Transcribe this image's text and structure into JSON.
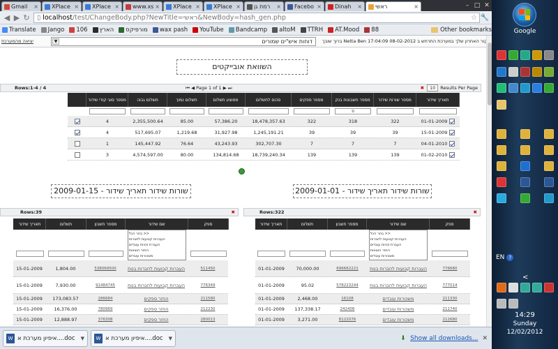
{
  "tabs": [
    {
      "label": "Gmail",
      "color": "#d44638"
    },
    {
      "label": "XPlace",
      "color": "#3a7bd5"
    },
    {
      "label": "XPlace",
      "color": "#3a7bd5"
    },
    {
      "label": "www.xs",
      "color": "#c43b3b"
    },
    {
      "label": "XPlace",
      "color": "#3a7bd5"
    },
    {
      "label": "XPlace",
      "color": "#3a7bd5"
    },
    {
      "label": "רמת גן",
      "color": "#555555"
    },
    {
      "label": "Facebo",
      "color": "#3b5998"
    },
    {
      "label": "Dinah",
      "color": "#cc2222"
    },
    {
      "label": "ראשי",
      "color": "#e8a33a"
    }
  ],
  "omnibox": {
    "host": "localhost",
    "path": "/test/ChangeBody.php?NewTitle=ראשי&NewBody=hash_gen.php"
  },
  "bookmarks": [
    {
      "label": "Translate",
      "color": "#4a8af4"
    },
    {
      "label": "Jango",
      "color": "#888888"
    },
    {
      "label": "106",
      "color": "#d04040"
    },
    {
      "label": "הארץ",
      "color": "#2b2b2b"
    },
    {
      "label": "מורפיקס",
      "color": "#2d6a2d"
    },
    {
      "label": "wax pash",
      "color": "#3b5998"
    },
    {
      "label": "YouTube",
      "color": "#cc0000"
    },
    {
      "label": "Bandcamp",
      "color": "#629aa9"
    },
    {
      "label": "altoM",
      "color": "#555555"
    },
    {
      "label": "TTRH",
      "color": "#444444"
    },
    {
      "label": "AT.Mood",
      "color": "#cc2222"
    },
    {
      "label": "88",
      "color": "#aa3333"
    }
  ],
  "other_bookmarks": "Other bookmarks",
  "topstrip": {
    "left_link": "יציאה מהמערכת",
    "select_value": "דוחות איש\"ים שמורים",
    "right_text": "ברוך שובך Netta Ben הביקור האחרון שלך במערכת התרחש ב 08-02-2012 17:04:09"
  },
  "main_title": "השוואת אובייקטים",
  "grid_top": {
    "rows_label": "Rows:1-4 / 4",
    "pager": "Page 1 of 1",
    "results_per_page": "Results Per Page",
    "rpp_value": "10",
    "headers": [
      "תאריך שידור",
      "מספר שורות שידור",
      "מספר חשבונות בנק",
      "מספר ספקים",
      "סכום לתשלום",
      "ממוצע תשלום",
      "תשלום נמוך",
      "תשלום גבוה",
      "מספר סוגי קודי שידור",
      ""
    ],
    "filter_value": "",
    "filter_bank": "פ",
    "rows": [
      {
        "date": "01-01-2009",
        "rows": "322",
        "banks": "318",
        "suppliers": "322",
        "sum": "18,478,357.63",
        "avg": "57,386.20",
        "low": "85.00",
        "high": "2,355,500.64",
        "types": "4",
        "checked": true,
        "date_checked": true
      },
      {
        "date": "15-01-2009",
        "rows": "39",
        "banks": "39",
        "suppliers": "39",
        "sum": "1,245,191.21",
        "avg": "31,927.98",
        "low": "1,219.68",
        "high": "517,695.07",
        "types": "4",
        "checked": true,
        "date_checked": true
      },
      {
        "date": "04-01-2010",
        "rows": "7",
        "banks": "7",
        "suppliers": "7",
        "sum": "302,707.30",
        "avg": "43,243.93",
        "low": "76.64",
        "high": "145,447.92",
        "types": "1",
        "checked": false,
        "date_checked": true
      },
      {
        "date": "01-02-2010",
        "rows": "139",
        "banks": "139",
        "suppliers": "139",
        "sum": "18,739,240.34",
        "avg": "134,814.68",
        "low": "80.00",
        "high": "4,574,597.00",
        "types": "3",
        "checked": false,
        "date_checked": true
      }
    ]
  },
  "section_right": {
    "title": "שורות שידור תאריך שידור - 2009-01-01",
    "rows_label": "Rows:322"
  },
  "section_left": {
    "title": "שורות שידור תאריך שידור - 2009-01-15",
    "rows_label": "Rows:39"
  },
  "sub_headers": [
    "ספק",
    "שם שידור",
    "מספר חשבון",
    "תשלום",
    "תאריך שידור"
  ],
  "multiselect_options": [
    "בחר הכל >>",
    "העברות קבועות לחברות",
    "העברת זכויות עובדים",
    "החזר הוצאות",
    "משכורות עובדים"
  ],
  "right_rows": [
    {
      "supplier": "776680",
      "name": "העברות קבועות לחברות בנות",
      "account": "696662221",
      "amount": "70,000.00",
      "date": "01-01-2009"
    },
    {
      "supplier": "777014",
      "name": "העברות קבועות לחברות בנות",
      "account": "578223244",
      "amount": "95.02",
      "date": "01-01-2009"
    },
    {
      "supplier": "211330",
      "name": "משכורות עובדים",
      "account": "16108",
      "amount": "2,468.00",
      "date": "01-01-2009"
    },
    {
      "supplier": "211740",
      "name": "משכורות עובדים",
      "account": "242406",
      "amount": "137,338.17",
      "date": "01-01-2009"
    },
    {
      "supplier": "212680",
      "name": "משכורות עובדים",
      "account": "8122076",
      "amount": "3,271.00",
      "date": "01-01-2009"
    }
  ],
  "left_rows": [
    {
      "supplier": "511450",
      "name": "העברות קבועות לחברות בנות",
      "account": "538069500",
      "amount": "1,804.00",
      "date": "15-01-2009"
    },
    {
      "supplier": "776349",
      "name": "העברות קבועות לחברות בנות",
      "account": "91484745",
      "amount": "7,930.00",
      "date": "15-01-2009"
    },
    {
      "supplier": "211580",
      "name": "החזר ספקים",
      "account": "286684",
      "amount": "173,083.57",
      "date": "15-01-2009"
    },
    {
      "supplier": "212230",
      "name": "החזר ספקים",
      "account": "780969",
      "amount": "16,376.00",
      "date": "15-01-2009"
    },
    {
      "supplier": "280013",
      "name": "החזר ספקים",
      "account": "376308",
      "amount": "12,888.97",
      "date": "15-01-2009"
    }
  ],
  "downloads": [
    {
      "label": "איפיון מערכת א....doc"
    },
    {
      "label": "איפיון מערכת א....doc"
    }
  ],
  "download_all": "Show all downloads...",
  "taskbar": {
    "google": "Google",
    "lang": "EN",
    "time": "14:29",
    "day": "Sunday",
    "date": "12/02/2012"
  }
}
